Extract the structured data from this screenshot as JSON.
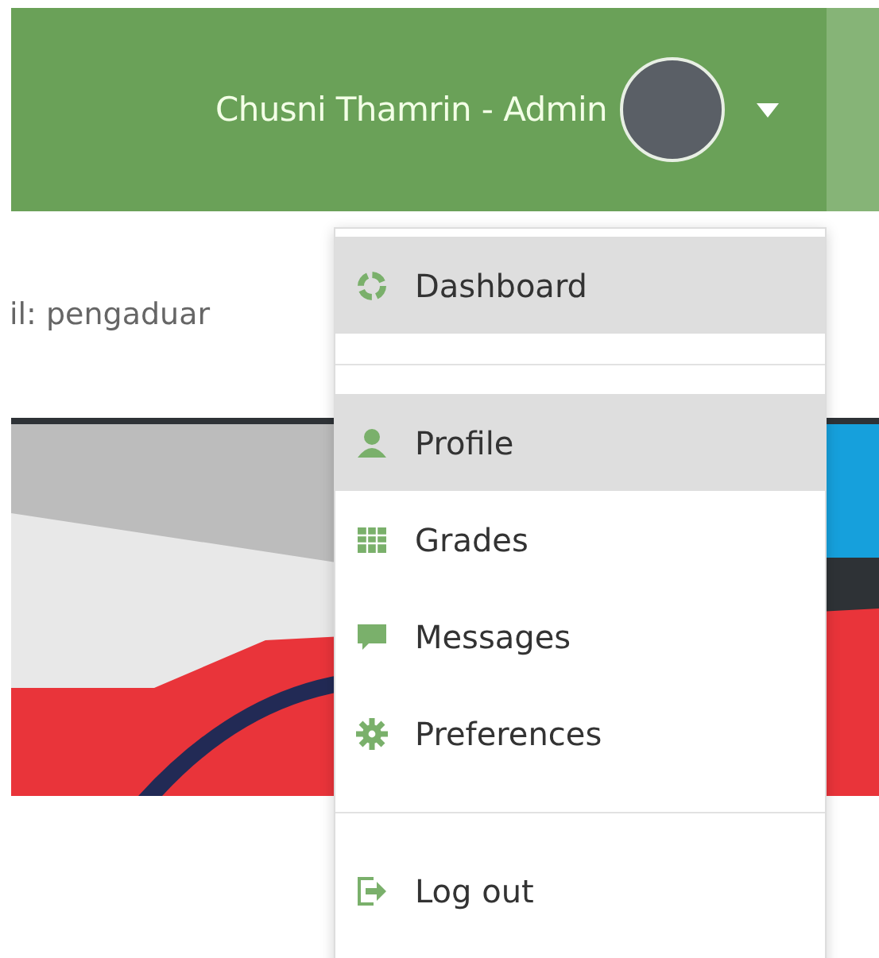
{
  "header": {
    "user_name": "Chusni Thamrin - Admin"
  },
  "content": {
    "contact_text": "il: pengaduar"
  },
  "user_menu": {
    "items": [
      {
        "kind": "dashboard",
        "label": "Dashboard",
        "highlighted": true
      },
      {
        "kind": "divider"
      },
      {
        "kind": "profile",
        "label": "Profile",
        "highlighted": true
      },
      {
        "kind": "grades",
        "label": "Grades",
        "highlighted": false
      },
      {
        "kind": "messages",
        "label": "Messages",
        "highlighted": false
      },
      {
        "kind": "preferences",
        "label": "Preferences",
        "highlighted": false
      },
      {
        "kind": "divider"
      },
      {
        "kind": "logout",
        "label": "Log out",
        "highlighted": false
      }
    ]
  }
}
